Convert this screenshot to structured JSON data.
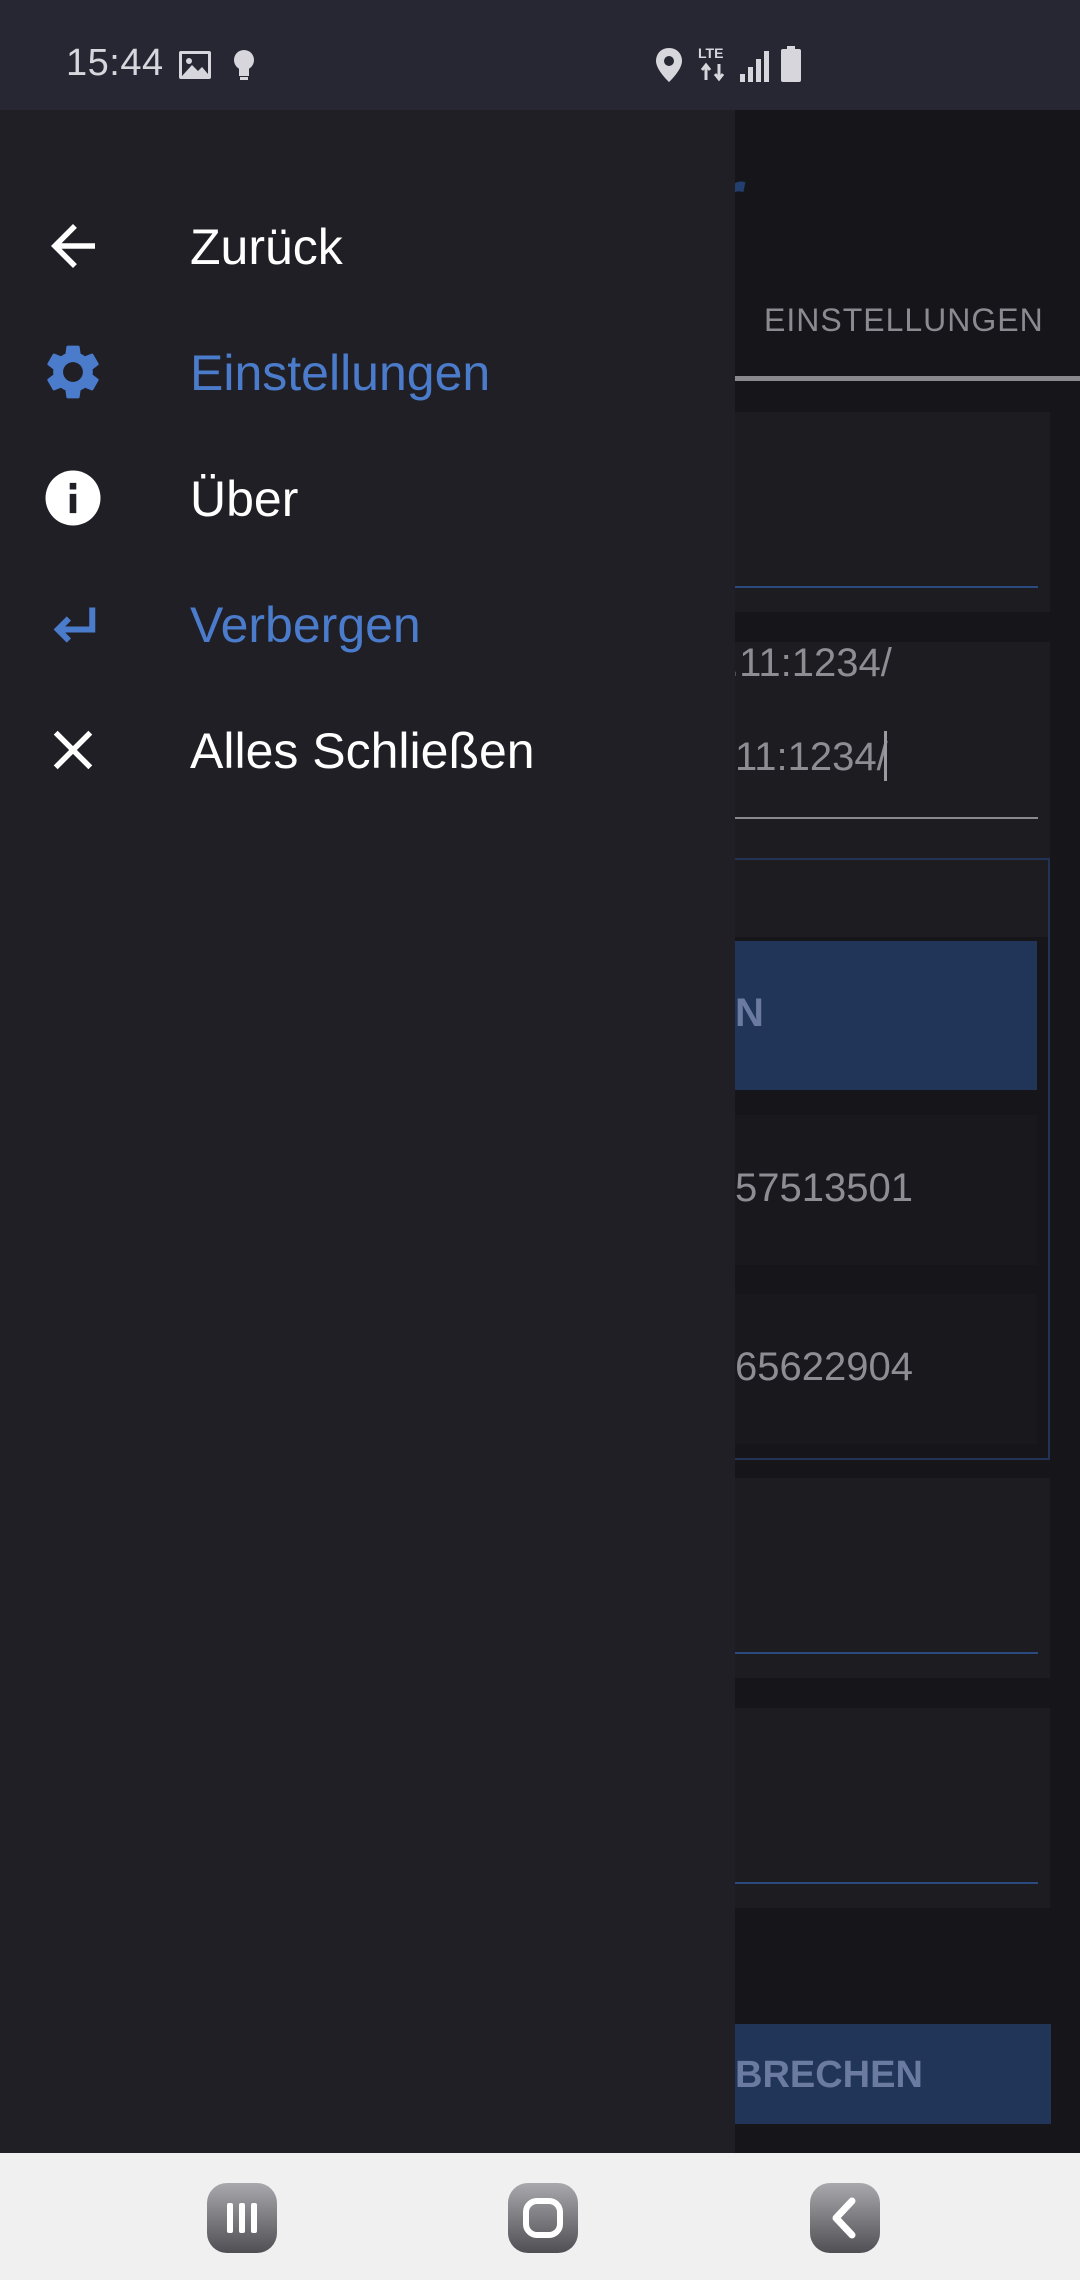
{
  "status_bar": {
    "time": "15:44",
    "icons": [
      "image-icon",
      "bulb-icon",
      "location-icon",
      "lte-icon",
      "signal-icon",
      "battery-icon"
    ]
  },
  "background_app": {
    "title_fragment": "r",
    "tab_label": "EINSTELLUNGEN",
    "field_value_1": ".11:1234/",
    "field_value_2": "11:1234/",
    "button_fragment": "N",
    "row_value_1": "57513501",
    "row_value_2": "65622904",
    "cancel_fragment": "BRECHEN"
  },
  "drawer": {
    "items": [
      {
        "label": "Zurück",
        "icon": "arrow-back-icon",
        "color": "#ffffff"
      },
      {
        "label": "Einstellungen",
        "icon": "gear-icon",
        "color": "#4b7ccc"
      },
      {
        "label": "Über",
        "icon": "info-icon",
        "color": "#ffffff"
      },
      {
        "label": "Verbergen",
        "icon": "return-icon",
        "color": "#4b7ccc"
      },
      {
        "label": "Alles Schließen",
        "icon": "close-icon",
        "color": "#ffffff"
      }
    ]
  },
  "nav_bar": {
    "buttons": [
      "recents-button",
      "home-button",
      "back-button"
    ]
  },
  "colors": {
    "accent": "#4b7ccc",
    "drawer_bg": "#1f1f25",
    "status_bar_bg": "#272733"
  }
}
